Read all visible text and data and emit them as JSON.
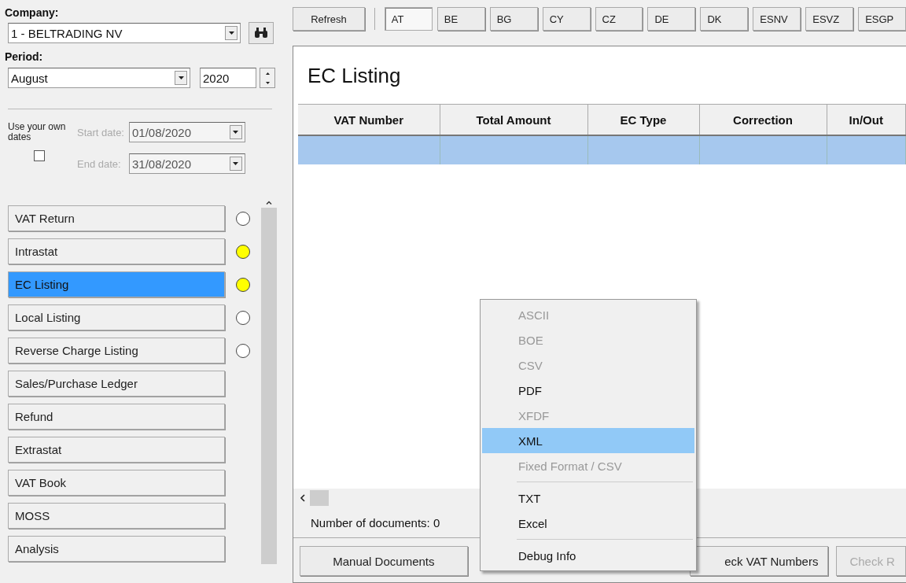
{
  "sidebar": {
    "company_label": "Company:",
    "company": "1 - BELTRADING NV",
    "period_label": "Period:",
    "month": "August",
    "year": "2020",
    "own_dates": {
      "label": "Use your own dates",
      "checked": false,
      "start_label": "Start date:",
      "start": "01/08/2020",
      "end_label": "End date:",
      "end": "31/08/2020",
      "disabled": true
    },
    "items": [
      {
        "label": "VAT Return",
        "selected": false,
        "color": "#ffffff"
      },
      {
        "label": "Intrastat",
        "selected": false,
        "color": "#ffff00"
      },
      {
        "label": "EC Listing",
        "selected": true,
        "color": "#ffff00"
      },
      {
        "label": "Local Listing",
        "selected": false,
        "color": "#ffffff"
      },
      {
        "label": "Reverse Charge Listing",
        "selected": false,
        "color": "#ffffff"
      },
      {
        "label": "Sales/Purchase Ledger",
        "selected": false
      },
      {
        "label": "Refund",
        "selected": false
      },
      {
        "label": "Extrastat",
        "selected": false
      },
      {
        "label": "VAT Book",
        "selected": false
      },
      {
        "label": "MOSS",
        "selected": false
      },
      {
        "label": "Analysis",
        "selected": false
      }
    ]
  },
  "toolbar": {
    "refresh": "Refresh",
    "countries": [
      {
        "label": "AT",
        "selected": true
      },
      {
        "label": "BE",
        "selected": false
      },
      {
        "label": "BG",
        "selected": false
      },
      {
        "label": "CY",
        "selected": false
      },
      {
        "label": "CZ",
        "selected": false
      },
      {
        "label": "DE",
        "selected": false
      },
      {
        "label": "DK",
        "selected": false
      },
      {
        "label": "ESNV",
        "selected": false
      },
      {
        "label": "ESVZ",
        "selected": false
      },
      {
        "label": "ESGP",
        "selected": false
      }
    ]
  },
  "panel": {
    "title": "EC Listing",
    "table": {
      "columns": [
        "VAT Number",
        "Total Amount",
        "EC Type",
        "Correction",
        "In/Out"
      ],
      "rows": [
        {
          "selected": true
        }
      ]
    },
    "status": "Number of documents: 0",
    "buttons": [
      {
        "label": "Manual Documents",
        "disabled": false
      },
      {
        "label": "eck VAT Numbers",
        "disabled": false
      },
      {
        "label": "Check R",
        "disabled": true
      }
    ]
  },
  "menu": {
    "items": [
      {
        "kind": "item",
        "label": "ASCII",
        "disabled": true,
        "selected": false
      },
      {
        "kind": "item",
        "label": "BOE",
        "disabled": true,
        "selected": false
      },
      {
        "kind": "item",
        "label": "CSV",
        "disabled": true,
        "selected": false
      },
      {
        "kind": "item",
        "label": "PDF",
        "disabled": false,
        "selected": false
      },
      {
        "kind": "item",
        "label": "XFDF",
        "disabled": true,
        "selected": false
      },
      {
        "kind": "item",
        "label": "XML",
        "disabled": false,
        "selected": true
      },
      {
        "kind": "item",
        "label": "Fixed Format / CSV",
        "disabled": true,
        "selected": false
      },
      {
        "kind": "separator"
      },
      {
        "kind": "item",
        "label": "TXT",
        "disabled": false,
        "selected": false
      },
      {
        "kind": "item",
        "label": "Excel",
        "disabled": false,
        "selected": false
      },
      {
        "kind": "separator"
      },
      {
        "kind": "item",
        "label": "Debug Info",
        "disabled": false,
        "selected": false
      }
    ]
  }
}
